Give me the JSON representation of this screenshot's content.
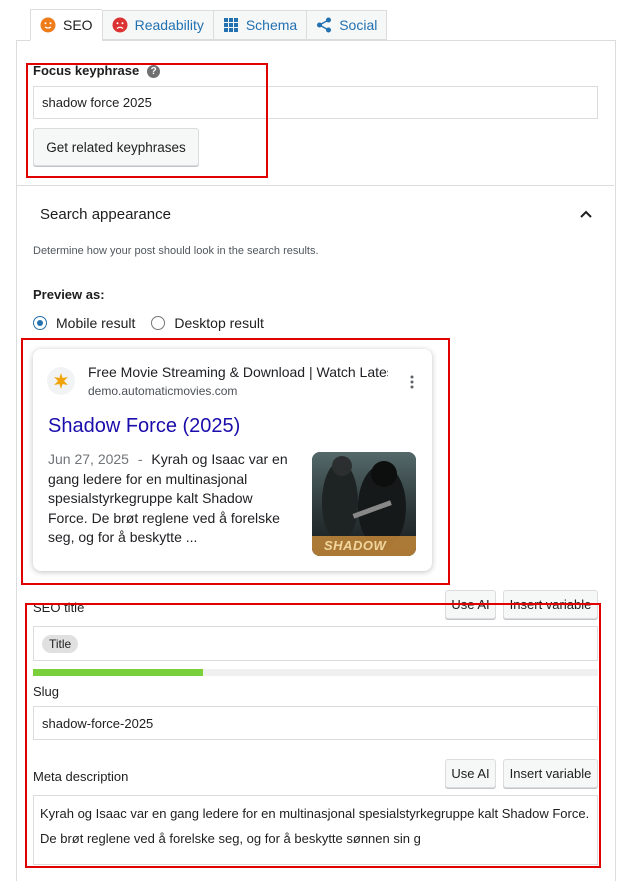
{
  "tabs": [
    {
      "label": "SEO",
      "icon": "orange-smiley-icon"
    },
    {
      "label": "Readability",
      "icon": "red-sad-face-icon"
    },
    {
      "label": "Schema",
      "icon": "grid-icon"
    },
    {
      "label": "Social",
      "icon": "share-icon"
    }
  ],
  "focus": {
    "label": "Focus keyphrase",
    "help": "?",
    "value": "shadow force 2025",
    "related_button": "Get related keyphrases"
  },
  "search_appearance": {
    "title": "Search appearance",
    "description": "Determine how your post should look in the search results.",
    "preview_label": "Preview as:",
    "mobile_label": "Mobile result",
    "desktop_label": "Desktop result"
  },
  "preview": {
    "site_title": "Free Movie Streaming & Download | Watch Lates",
    "site_url": "demo.automaticmovies.com",
    "page_title": "Shadow Force (2025)",
    "date": "Jun 27, 2025",
    "separator": "-",
    "snippet": "Kyrah og Isaac var en gang ledere for en multinasjonal spesialstyrkegruppe kalt Shadow Force. De brøt reglene ved å forelske seg, og for å beskytte ...",
    "thumb_text": "SHADOW"
  },
  "seo_title": {
    "label": "SEO title",
    "token": "Title",
    "use_ai": "Use AI",
    "insert_variable": "Insert variable",
    "progress": 0.3
  },
  "slug": {
    "label": "Slug",
    "value": "shadow-force-2025"
  },
  "meta": {
    "label": "Meta description",
    "use_ai": "Use AI",
    "insert_variable": "Insert variable",
    "value": "Kyrah og Isaac var en gang ledere for en multinasjonal spesialstyrkegruppe kalt Shadow Force. De brøt reglene ved å forelske seg, og for å beskytte sønnen sin g"
  },
  "colors": {
    "accent": "#2271b1",
    "google_link": "#1a0dab",
    "progress_green": "#7ad03a",
    "highlight_red": "#e00000"
  }
}
